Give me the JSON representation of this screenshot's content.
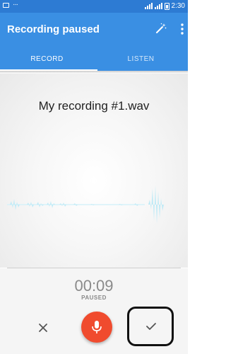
{
  "status_bar": {
    "time": "2:30",
    "icons": [
      "notification-box-icon",
      "more-dots-icon",
      "signal-icon",
      "signal-icon",
      "battery-icon"
    ]
  },
  "app_bar": {
    "title": "Recording paused",
    "actions": [
      "magic-wand-icon",
      "overflow-menu-icon"
    ]
  },
  "tabs": [
    {
      "label": "RECORD",
      "selected": true
    },
    {
      "label": "LISTEN",
      "selected": false
    }
  ],
  "recording": {
    "file_name": "My recording #1.wav",
    "elapsed": "00:09",
    "state_label": "PAUSED"
  },
  "controls": [
    "discard-icon",
    "mic-icon",
    "done-check-icon"
  ],
  "colors": {
    "status_bar": "#2d7bd3",
    "app_bar": "#3a8fe3",
    "waveform": "#bfeaf6",
    "record_button": "#f04b2e",
    "timer_text": "#8a8a8a"
  }
}
